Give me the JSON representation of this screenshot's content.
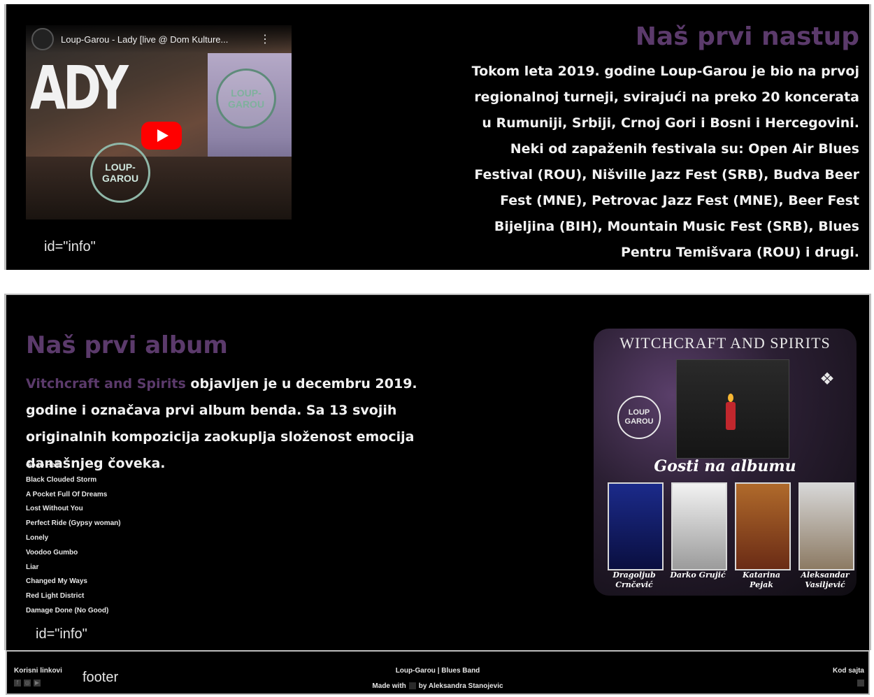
{
  "section1": {
    "video": {
      "title": "Loup-Garou - Lady [live @ Dom Kulture...",
      "menu_glyph": "⋮",
      "thumb_text": "ADY",
      "badge_text": "LOUP-\nGAROU"
    },
    "title": "Naš prvi nastup",
    "body": "Tokom leta 2019. godine Loup-Garou je bio na prvoj regionalnoj turneji, svirajući na preko 20 koncerata u Rumuniji, Srbiji, Crnoj Gori i Bosni i Hercegovini. Neki od zapaženih festivala su: Open Air Blues Festival (ROU), Nišville Jazz Fest (SRB), Budva Beer Fest (MNE), Petrovac Jazz Fest (MNE), Beer Fest Bijeljina (BIH), Mountain Music Fest (SRB), Blues Pentru Temišvara (ROU) i drugi.",
    "id_label": "id=\"info\""
  },
  "section2": {
    "title": "Naš prvi album",
    "album_name": "Vitchcraft and Spirits",
    "body": " objavljen je u decembru 2019. godine i označava prvi album benda. Sa 13 svojih originalnih kompozicija zaokuplja složenost emocija današnjeg čoveka.",
    "tracks": [
      "Go to Hell",
      "Black Clouded Storm",
      "A Pocket Full Of Dreams",
      "Lost Without You",
      "Perfect Ride (Gypsy woman)",
      "Lonely",
      "Voodoo Gumbo",
      "Liar",
      "Changed My Ways",
      "Red Light District",
      "Damage Done (No Good)"
    ],
    "cover": {
      "title": "WITCHCRAFT AND SPIRITS",
      "logo_text": "LOUP\nGAROU",
      "guests_heading": "Gosti na albumu",
      "guests": [
        {
          "name": "Dragoljub Crnčević"
        },
        {
          "name": "Darko Grujić"
        },
        {
          "name": "Katarina Pejak"
        },
        {
          "name": "Aleksandar Vasiljević"
        }
      ]
    },
    "id_label": "id=\"info\""
  },
  "footer": {
    "left_title": "Korisni linkovi",
    "label": "footer",
    "center_line1": "Loup-Garou | Blues Band",
    "center_line2_a": "Made with",
    "center_line2_b": "by Aleksandra Stanojevic",
    "right_title": "Kod sajta"
  },
  "colors": {
    "accent": "#5b3a6b",
    "background": "#000000",
    "youtube_red": "#ff0000"
  }
}
